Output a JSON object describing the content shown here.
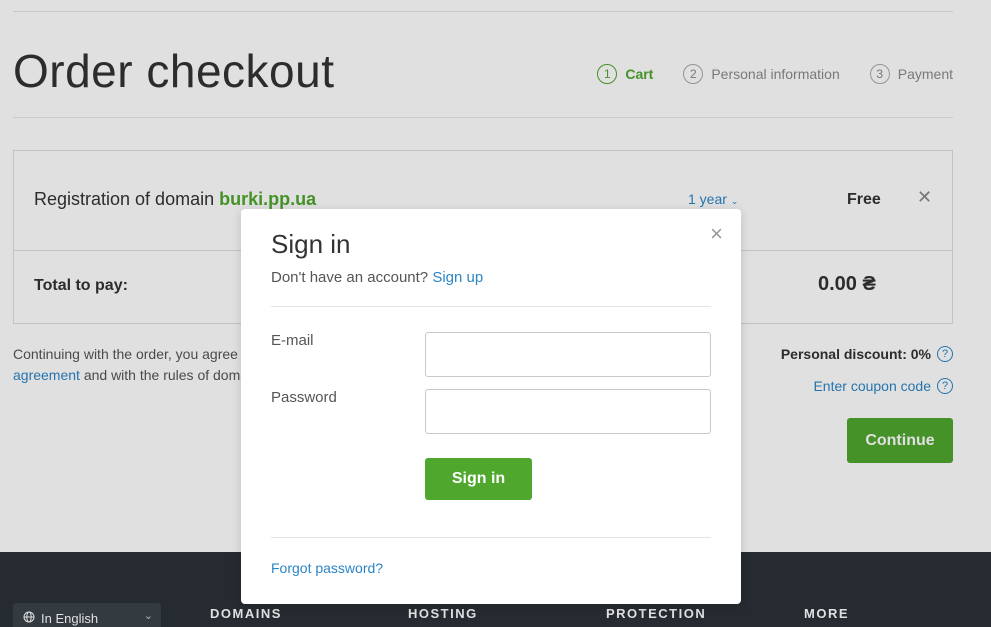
{
  "page": {
    "title": "Order checkout",
    "steps": [
      {
        "num": "1",
        "label": "Cart"
      },
      {
        "num": "2",
        "label": "Personal information"
      },
      {
        "num": "3",
        "label": "Payment"
      }
    ]
  },
  "cart": {
    "item_prefix": "Registration of domain",
    "domain": "burki.pp.ua",
    "period": "1 year",
    "price": "Free",
    "remove_symbol": "✕",
    "total_label": "Total to pay:",
    "total_value": "0.00 ₴"
  },
  "agreement": {
    "text_start": "Continuing with the order, you agree",
    "link": "agreement",
    "text_end": "and with the rules of doma"
  },
  "discount": {
    "label": "Personal discount: 0%",
    "coupon": "Enter coupon code",
    "help": "?"
  },
  "continue_label": "Continue",
  "footer": {
    "language": "In English",
    "headings": [
      "DOMAINS",
      "HOSTING",
      "PROTECTION",
      "MORE"
    ]
  },
  "modal": {
    "title": "Sign in",
    "no_account": "Don't have an account?",
    "signup": "Sign up",
    "email_label": "E-mail",
    "email_value": "",
    "password_label": "Password",
    "password_value": "",
    "submit": "Sign in",
    "forgot": "Forgot password?",
    "close_symbol": "×"
  },
  "colors": {
    "accent_green": "#4fa72e",
    "link_blue": "#2c85c6",
    "footer_dark": "#2b3137"
  }
}
